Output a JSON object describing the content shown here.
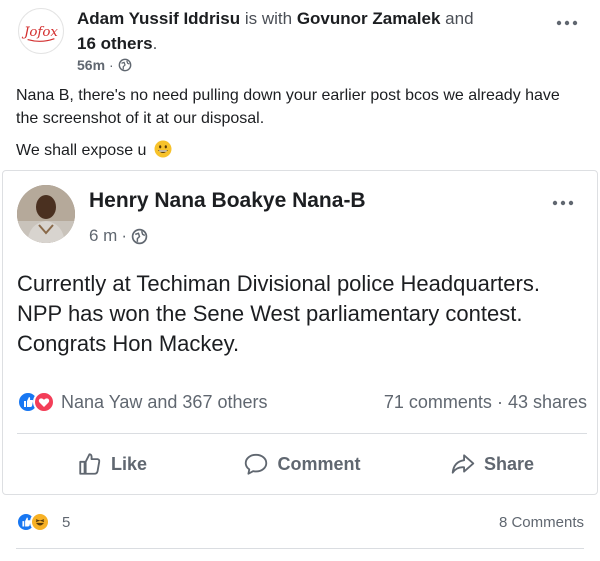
{
  "post": {
    "author": "Adam Yussif Iddrisu",
    "with_text": "is with",
    "tagged_primary": "Govunor Zamalek",
    "and_text": "and",
    "tagged_others": "16 others",
    "time": "56m",
    "body_line1": "Nana B, there's no need pulling  down your earlier post bcos we already have the screenshot of it at our disposal.",
    "body_line2": "We shall expose u",
    "reactions_count": "5",
    "comments_label": "8 Comments"
  },
  "shared_post": {
    "author": "Henry Nana Boakye Nana-B",
    "time": "6 m",
    "body": "Currently at Techiman Divisional police Headquarters. NPP has won the Sene West parliamentary contest. Congrats Hon Mackey.",
    "reactions_text": "Nana Yaw and 367 others",
    "comments_text": "71 comments",
    "shares_text": "43 shares",
    "actions": {
      "like": "Like",
      "comment": "Comment",
      "share": "Share"
    }
  },
  "logo_text": "Jofox",
  "icons": {
    "outer_avatar": "red-script-logo",
    "like_reaction": "like-icon",
    "love_reaction": "love-icon",
    "haha_reaction": "haha-icon",
    "globe": "globe-icon",
    "more": "more-options-icon"
  },
  "colors": {
    "like_blue": "#1877f2",
    "love_red": "#f33e58",
    "haha_yellow": "#f7b125",
    "muted_text": "#606770",
    "logo_red": "#d32f2f"
  }
}
